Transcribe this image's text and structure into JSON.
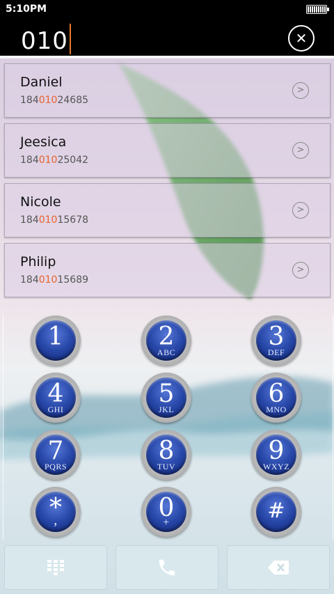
{
  "status_bar": {
    "time": "5:10PM",
    "battery_level": 1.0,
    "battery_icon": "battery-full-icon"
  },
  "dialer": {
    "input_value": "010",
    "clear_icon": "clear-icon",
    "accent_color": "#e8782f"
  },
  "results": [
    {
      "name": "Daniel",
      "number_prefix": "184",
      "number_match": "010",
      "number_suffix": "24685"
    },
    {
      "name": "Jeesica",
      "number_prefix": "184",
      "number_match": "010",
      "number_suffix": "25042"
    },
    {
      "name": "Nicole",
      "number_prefix": "184",
      "number_match": "010",
      "number_suffix": "15678"
    },
    {
      "name": "Philip",
      "number_prefix": "184",
      "number_match": "010",
      "number_suffix": "15689"
    }
  ],
  "keypad": {
    "keys": [
      {
        "digit": "1",
        "letters": ""
      },
      {
        "digit": "2",
        "letters": "ABC"
      },
      {
        "digit": "3",
        "letters": "DEF"
      },
      {
        "digit": "4",
        "letters": "GHI"
      },
      {
        "digit": "5",
        "letters": "JKL"
      },
      {
        "digit": "6",
        "letters": "MNO"
      },
      {
        "digit": "7",
        "letters": "PQRS"
      },
      {
        "digit": "8",
        "letters": "TUV"
      },
      {
        "digit": "9",
        "letters": "WXYZ"
      },
      {
        "digit": "*",
        "letters": ","
      },
      {
        "digit": "0",
        "letters": "+"
      },
      {
        "digit": "#",
        "letters": ""
      }
    ]
  },
  "bottom_bar": {
    "keypad_icon": "dialpad-icon",
    "call_icon": "phone-icon",
    "backspace_icon": "backspace-icon"
  },
  "highlight_color": "#e8622a"
}
